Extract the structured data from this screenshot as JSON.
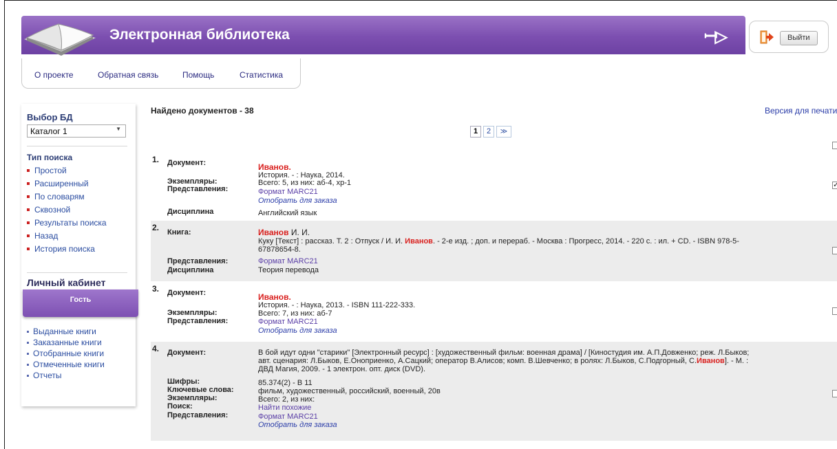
{
  "header": {
    "title": "Электронная библиотека",
    "logo_mark": "ꟷ▷",
    "exit_label": "Выйти",
    "accent": "#7c4fb0"
  },
  "topnav": [
    "О проекте",
    "Обратная связь",
    "Помощь",
    "Статистика"
  ],
  "sidebar": {
    "db_heading": "Выбор БД",
    "db_selected": "Каталог 1",
    "search_heading": "Тип поиска",
    "search_items": [
      "Простой",
      "Расширенный",
      "По словарям",
      "Сквозной",
      "Результаты поиска",
      "Назад",
      "История поиска"
    ],
    "cabinet_heading": "Личный кабинет",
    "guest_label": "Гость",
    "cabinet_items": [
      "Выданные книги",
      "Заказанные книги",
      "Отобранные книги",
      "Отмеченные книги",
      "Отчеты"
    ]
  },
  "results": {
    "found_text": "Найдено документов - 38",
    "print_link": "Версия для печати",
    "pages": [
      "1",
      "2",
      "≫"
    ],
    "records": [
      {
        "num": "1.",
        "l_doc": "Документ:",
        "author": "Иванов.",
        "title": "История. - : Наука, 2014.",
        "l_copies": "Экземпляры:",
        "copies": "Всего: 5, из них: аб-4, хр-1",
        "l_repr": "Представления:",
        "format": "Формат MARC21",
        "order": "Отобрать для заказа",
        "l_disc": "Дисциплина",
        "disc": "Английский язык",
        "checked": true
      },
      {
        "num": "2.",
        "l_book": "Книга:",
        "author": "Иванов",
        "author_rest": " И. И.",
        "desc_a": "Куку [Текст] : рассказ. Т. 2 : Отпуск / И. И. ",
        "desc_hl": "Иванов",
        "desc_b": ". - 2-е изд. ; доп. и перераб. - Москва : Прогресс, 2014. - 220 с. : ил. + CD. - ISBN 978-5-",
        "desc_c": "67878654-8.",
        "l_repr": "Представления:",
        "format": "Формат MARC21",
        "l_disc": "Дисциплина",
        "disc": "Теория перевода",
        "checked": false
      },
      {
        "num": "3.",
        "l_doc": "Документ:",
        "author": "Иванов.",
        "title": "История. - : Наука, 2013. - ISBN 111-222-333.",
        "l_copies": "Экземпляры:",
        "copies": "Всего: 7, из них: аб-7",
        "l_repr": "Представления:",
        "format": "Формат MARC21",
        "order": "Отобрать для заказа",
        "checked": false
      },
      {
        "num": "4.",
        "l_doc": "Документ:",
        "line1": "В бой идут одни \"старики\" [Электронный ресурс] : [художественный фильм: военная драма] / [Киностудия им. А.П.Довженко; реж. Л.Быков;",
        "line2a": "авт. сценария: Л.Быков, Е.Оноприенко, А.Сацкий; оператор В.Алисов; комп. В.Шевченко; в ролях: Л.Быков, С.Подгорный, С.",
        "line2hl": "Иванов",
        "line2b": "]. - М. :",
        "line3": "ДВД Магия, 2009. - 1 электрон. опт. диск (DVD).",
        "l_cipher": "Шифры:",
        "cipher": "85.374(2) - В 11",
        "l_kw": "Ключевые слова:",
        "kw": "фильм, художественный, российский, военный, 20в",
        "l_copies": "Экземпляры:",
        "copies": "Всего: 2, из них:",
        "l_search": "Поиск:",
        "similar": "Найти похожие",
        "l_repr": "Представления:",
        "format": "Формат MARC21",
        "order": "Отобрать для заказа",
        "checked": false
      }
    ]
  }
}
